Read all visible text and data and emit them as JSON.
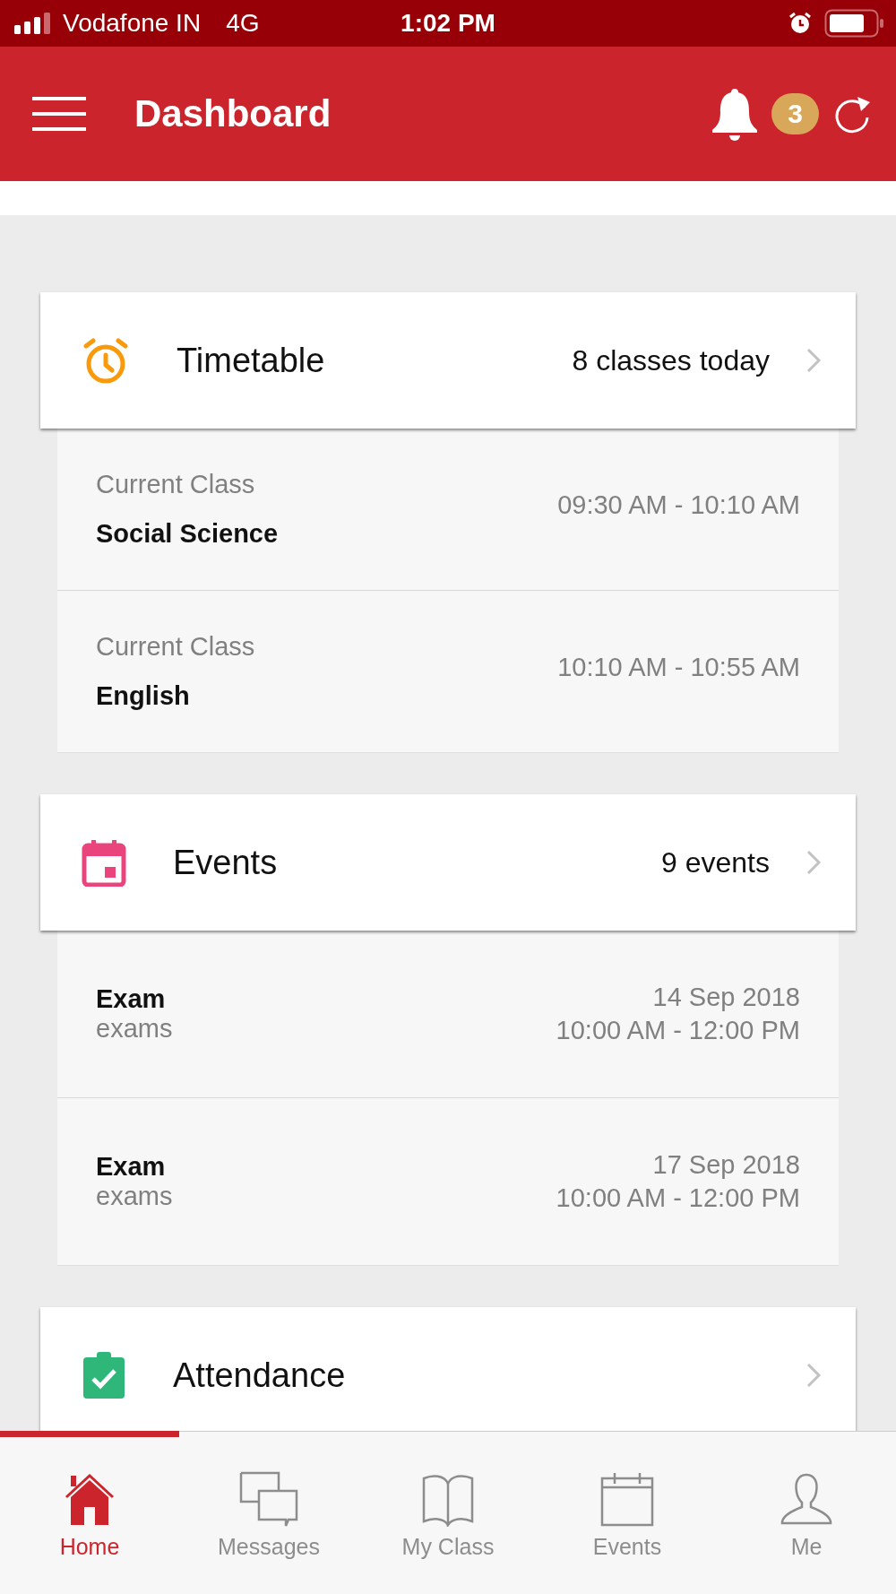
{
  "status_bar": {
    "carrier": "Vodafone IN",
    "network": "4G",
    "time": "1:02 PM"
  },
  "header": {
    "title": "Dashboard",
    "badge": "3"
  },
  "sections": [
    {
      "kind": "timetable",
      "title": "Timetable",
      "summary": "8 classes today",
      "rows": [
        {
          "kind": "class",
          "label": "Current Class",
          "subject": "Social Science",
          "time": "09:30 AM - 10:10 AM"
        },
        {
          "kind": "class",
          "label": "Current Class",
          "subject": "English",
          "time": "10:10 AM - 10:55 AM"
        }
      ]
    },
    {
      "kind": "events",
      "title": "Events",
      "summary": "9 events",
      "rows": [
        {
          "kind": "event",
          "title": "Exam",
          "subtitle": "exams",
          "date": "14 Sep 2018",
          "time": "10:00 AM - 12:00 PM"
        },
        {
          "kind": "event",
          "title": "Exam",
          "subtitle": "exams",
          "date": "17 Sep 2018",
          "time": "10:00 AM - 12:00 PM"
        }
      ]
    },
    {
      "kind": "attendance",
      "title": "Attendance"
    }
  ],
  "tabs": [
    {
      "kind": "home",
      "label": "Home",
      "selected": true
    },
    {
      "kind": "messages",
      "label": "Messages",
      "selected": false
    },
    {
      "kind": "class",
      "label": "My Class",
      "selected": false
    },
    {
      "kind": "events",
      "label": "Events",
      "selected": false
    },
    {
      "kind": "me",
      "label": "Me",
      "selected": false
    }
  ]
}
